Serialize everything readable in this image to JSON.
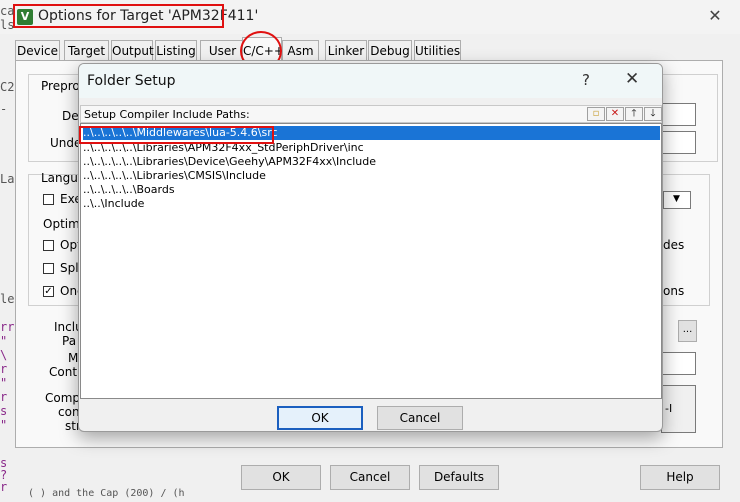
{
  "main_window": {
    "title": "Options for Target 'APM32F411'",
    "close_glyph": "✕",
    "icon": "uvision-logo-icon",
    "tabs": [
      "Device",
      "Target",
      "Output",
      "Listing",
      "User",
      "C/C++",
      "Asm",
      "Linker",
      "Debug",
      "Utilities"
    ],
    "active_tab": "C/C++",
    "partial_labels": {
      "preprocessor": "Prepro",
      "define": "De",
      "undefine": "Unde",
      "language": "Langu",
      "execute": "Exe",
      "optimization": "Optimi",
      "opt": "Opt",
      "split": "Spl",
      "one": "One",
      "include": "Inclu",
      "paths": "Pa",
      "misc": "M",
      "controls": "Contr",
      "compiler": "Comp",
      "control": "con",
      "string": "str",
      "right_des": "des",
      "right_ons": "ons",
      "right_l": "-I",
      "browse": "..."
    },
    "buttons": {
      "ok": "OK",
      "cancel": "Cancel",
      "defaults": "Defaults",
      "help": "Help"
    }
  },
  "left_edge_text": [
    "ca",
    "ls",
    "C2",
    "-",
    "La",
    "le",
    "rr",
    "\"",
    "\\",
    "r",
    "\"",
    "r",
    "s",
    "\"",
    "s",
    "?",
    "r",
    ")"
  ],
  "bottom_edge_text": "( ) and the Cap (200) / (h",
  "folder_setup": {
    "title": "Folder Setup",
    "help_glyph": "?",
    "close_glyph": "✕",
    "header_label": "Setup Compiler Include Paths:",
    "toolbar": [
      "new-folder-icon",
      "delete-icon",
      "move-up-icon",
      "move-down-icon"
    ],
    "paths": [
      "..\\..\\..\\..\\..\\Middlewares\\lua-5.4.6\\src",
      "..\\..\\..\\..\\..\\Libraries\\APM32F4xx_StdPeriphDriver\\inc",
      "..\\..\\..\\..\\..\\Libraries\\Device\\Geehy\\APM32F4xx\\Include",
      "..\\..\\..\\..\\..\\Libraries\\CMSIS\\Include",
      "..\\..\\..\\..\\..\\Boards",
      "..\\..\\Include"
    ],
    "selected_index": 0,
    "ok_label": "OK",
    "cancel_label": "Cancel"
  }
}
